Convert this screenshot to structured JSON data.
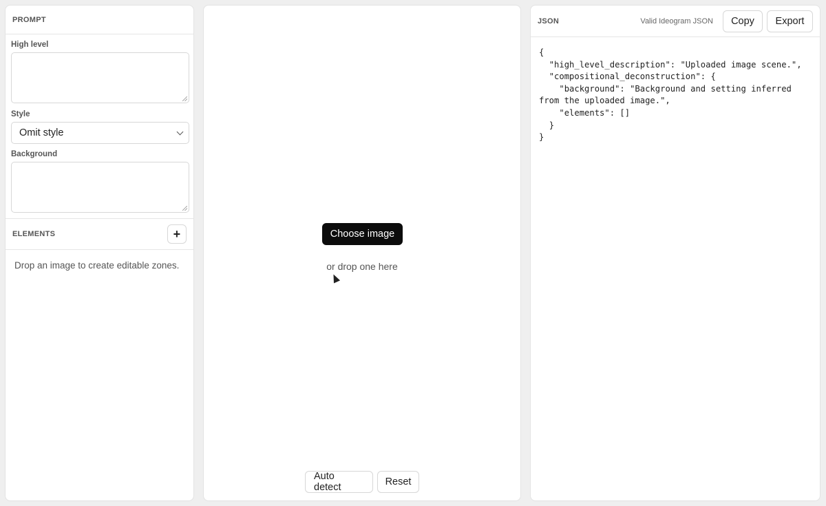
{
  "prompt": {
    "section_title": "PROMPT",
    "high_level_label": "High level",
    "high_level_value": "",
    "style_label": "Style",
    "style_selected": "Omit style",
    "background_label": "Background",
    "background_value": ""
  },
  "elements": {
    "section_title": "ELEMENTS",
    "add_label": "+",
    "empty_text": "Drop an image to create editable zones."
  },
  "canvas": {
    "choose_label": "Choose image",
    "drop_text": "or drop one here",
    "auto_detect_label": "Auto detect",
    "reset_label": "Reset"
  },
  "json_panel": {
    "title": "JSON",
    "status": "Valid Ideogram JSON",
    "copy_label": "Copy",
    "export_label": "Export",
    "content": "{\n  \"high_level_description\": \"Uploaded image scene.\",\n  \"compositional_deconstruction\": {\n    \"background\": \"Background and setting inferred from the uploaded image.\",\n    \"elements\": []\n  }\n}"
  }
}
